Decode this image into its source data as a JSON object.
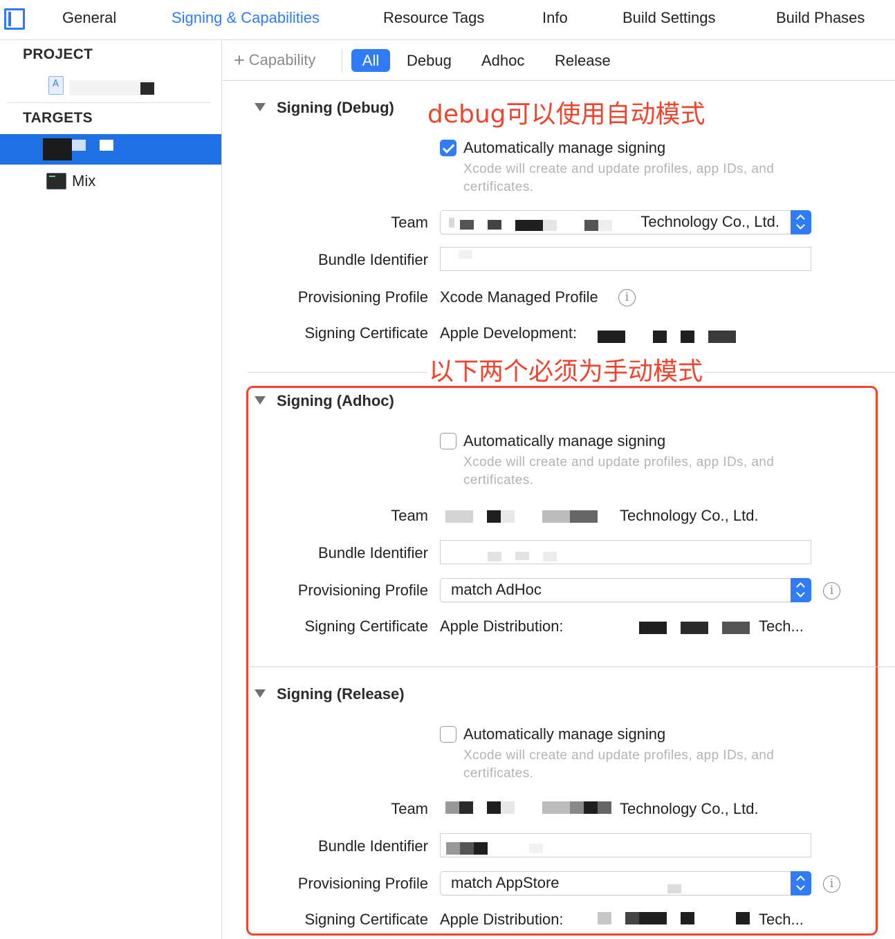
{
  "top_tabs": [
    {
      "label": "General"
    },
    {
      "label": "Signing & Capabilities"
    },
    {
      "label": "Resource Tags"
    },
    {
      "label": "Info"
    },
    {
      "label": "Build Settings"
    },
    {
      "label": "Build Phases"
    }
  ],
  "active_tab": "Signing & Capabilities",
  "accent_color": "#2f7cf6",
  "annotation_color": "#f0442c",
  "sidebar": {
    "project_header": "PROJECT",
    "targets_header": "TARGETS",
    "targets": [
      {
        "label": "",
        "selected": true
      },
      {
        "label": "Mix",
        "selected": false
      }
    ]
  },
  "filter_bar": {
    "capability_label": "Capability",
    "segments": [
      "All",
      "Debug",
      "Adhoc",
      "Release"
    ],
    "selected": "All"
  },
  "annotations": {
    "debug_note": "debug可以使用自动模式",
    "manual_note": "以下两个必须为手动模式"
  },
  "labels": {
    "team": "Team",
    "bundle_identifier": "Bundle Identifier",
    "provisioning_profile": "Provisioning Profile",
    "signing_certificate": "Signing Certificate",
    "auto_manage": "Automatically manage signing",
    "auto_manage_hint": "Xcode will create and update profiles, app IDs, and certificates."
  },
  "sections": [
    {
      "title": "Signing (Debug)",
      "auto_manage_checked": true,
      "team": "Technology Co., Ltd.",
      "provisioning_profile": "Xcode Managed Profile",
      "signing_certificate": "Apple Development:"
    },
    {
      "title": "Signing (Adhoc)",
      "auto_manage_checked": false,
      "team": "Technology Co., Ltd.",
      "provisioning_profile": "match AdHoc",
      "signing_certificate": "Apple Distribution:",
      "signing_certificate_suffix": "Tech..."
    },
    {
      "title": "Signing (Release)",
      "auto_manage_checked": false,
      "team": "Technology Co., Ltd.",
      "provisioning_profile": "match AppStore",
      "signing_certificate": "Apple Distribution:",
      "signing_certificate_suffix": "Tech..."
    }
  ]
}
